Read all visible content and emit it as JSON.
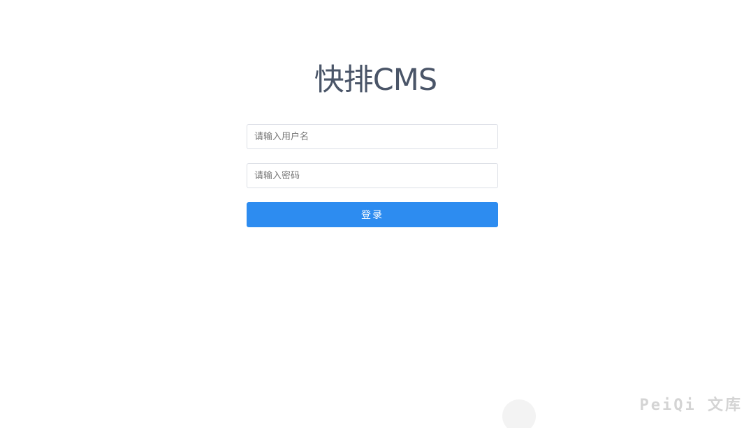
{
  "login": {
    "title": "快排CMS",
    "username_placeholder": "请输入用户名",
    "username_value": "",
    "password_placeholder": "请输入密码",
    "password_value": "",
    "submit_label": "登录"
  },
  "watermark": {
    "text": "PeiQi 文库"
  },
  "colors": {
    "title": "#4a5568",
    "button_bg": "#2d8cf0",
    "button_text": "#ffffff",
    "input_border": "#dcdfe6",
    "watermark": "#d4d4d4"
  }
}
